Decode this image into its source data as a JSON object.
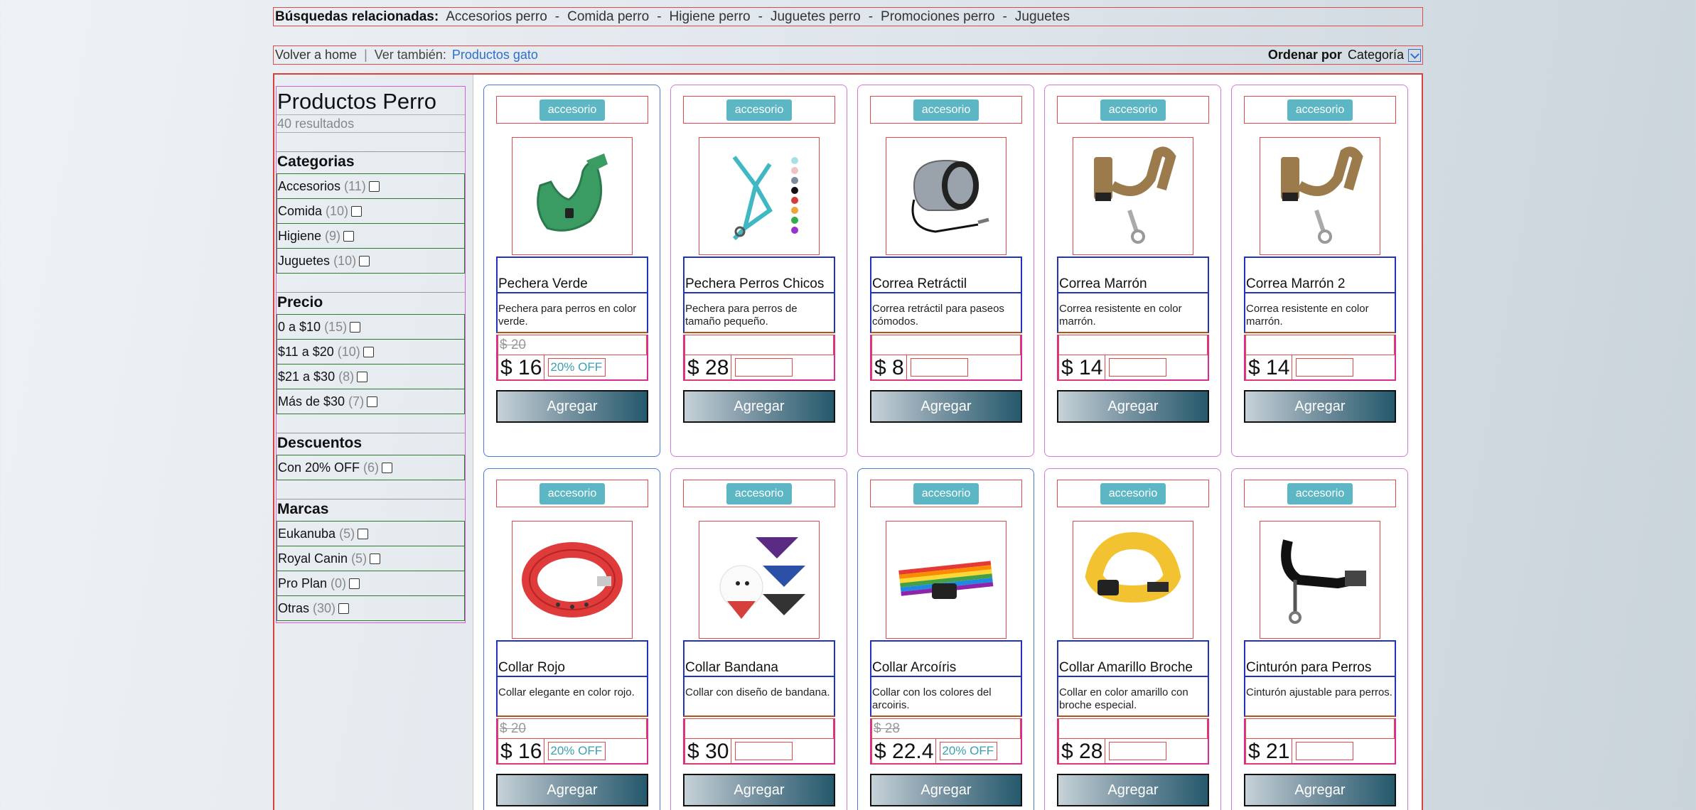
{
  "related": {
    "title": "Búsquedas relacionadas:",
    "items": [
      "Accesorios perro",
      "Comida perro",
      "Higiene perro",
      "Juguetes perro",
      "Promociones perro",
      "Juguetes"
    ]
  },
  "nav": {
    "back": "Volver a home",
    "see_also": "Ver también:",
    "see_also_link": "Productos gato",
    "sort_label": "Ordenar por",
    "sort_value": "Categoría"
  },
  "sidebar": {
    "title": "Productos Perro",
    "results": "40 resultados",
    "sections": [
      {
        "title": "Categorias",
        "options": [
          {
            "label": "Accesorios",
            "count": "(11)"
          },
          {
            "label": "Comida",
            "count": "(10)"
          },
          {
            "label": "Higiene",
            "count": "(9)"
          },
          {
            "label": "Juguetes",
            "count": "(10)"
          }
        ]
      },
      {
        "title": "Precio",
        "options": [
          {
            "label": "0 a $10",
            "count": "(15)"
          },
          {
            "label": "$11 a $20",
            "count": "(10)"
          },
          {
            "label": "$21 a $30",
            "count": "(8)"
          },
          {
            "label": "Más de $30",
            "count": "(7)"
          }
        ]
      },
      {
        "title": "Descuentos",
        "options": [
          {
            "label": "Con 20% OFF",
            "count": "(6)"
          }
        ]
      },
      {
        "title": "Marcas",
        "options": [
          {
            "label": "Eukanuba",
            "count": "(5)"
          },
          {
            "label": "Royal Canin",
            "count": "(5)"
          },
          {
            "label": "Pro Plan",
            "count": "(0)"
          },
          {
            "label": "Otras",
            "count": "(30)"
          }
        ]
      }
    ]
  },
  "products": [
    {
      "tag": "accesorio",
      "name": "Pechera Verde",
      "desc": "Pechera para perros en color verde.",
      "old": "$ 20",
      "price": "$ 16",
      "off": "20% OFF",
      "img": "harness-green"
    },
    {
      "tag": "accesorio",
      "name": "Pechera Perros Chicos",
      "desc": "Pechera para perros de tamaño pequeño.",
      "old": "",
      "price": "$ 28",
      "off": "",
      "img": "harness-small"
    },
    {
      "tag": "accesorio",
      "name": "Correa Retráctil",
      "desc": "Correa retráctil para paseos cómodos.",
      "old": "",
      "price": "$ 8",
      "off": "",
      "img": "retractable-leash"
    },
    {
      "tag": "accesorio",
      "name": "Correa Marrón",
      "desc": "Correa resistente en color marrón.",
      "old": "",
      "price": "$ 14",
      "off": "",
      "img": "leash-brown"
    },
    {
      "tag": "accesorio",
      "name": "Correa Marrón 2",
      "desc": "Correa resistente en color marrón.",
      "old": "",
      "price": "$ 14",
      "off": "",
      "img": "leash-brown"
    },
    {
      "tag": "accesorio",
      "name": "Collar Rojo",
      "desc": "Collar elegante en color rojo.",
      "old": "$ 20",
      "price": "$ 16",
      "off": "20% OFF",
      "img": "collar-red"
    },
    {
      "tag": "accesorio",
      "name": "Collar Bandana",
      "desc": "Collar con diseño de bandana.",
      "old": "",
      "price": "$ 30",
      "off": "",
      "img": "bandana"
    },
    {
      "tag": "accesorio",
      "name": "Collar Arcoíris",
      "desc": "Collar con los colores del arcoiris.",
      "old": "$ 28",
      "price": "$ 22.4",
      "off": "20% OFF",
      "img": "collar-rainbow"
    },
    {
      "tag": "accesorio",
      "name": "Collar Amarillo Broche",
      "desc": "Collar en color amarillo con broche especial.",
      "old": "",
      "price": "$ 28",
      "off": "",
      "img": "collar-yellow"
    },
    {
      "tag": "accesorio",
      "name": "Cinturón para Perros",
      "desc": "Cinturón ajustable para perros.",
      "old": "",
      "price": "$ 21",
      "off": "",
      "img": "seatbelt"
    }
  ],
  "add_label": "Agregar",
  "colors": {
    "accent": "#5cb6c4",
    "link": "#2d6fd1",
    "button_dark": "#24596c"
  }
}
